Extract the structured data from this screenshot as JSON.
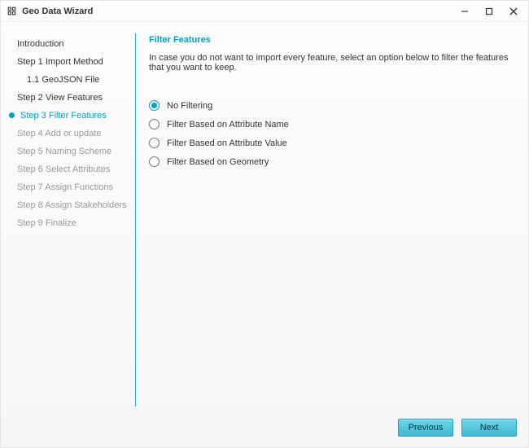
{
  "window": {
    "title": "Geo Data Wizard"
  },
  "sidebar": {
    "items": [
      {
        "label": "Introduction",
        "state": "past",
        "indent": 0
      },
      {
        "label": "Step 1 Import Method",
        "state": "past",
        "indent": 0
      },
      {
        "label": "1.1 GeoJSON File",
        "state": "past",
        "indent": 1
      },
      {
        "label": "Step 2 View Features",
        "state": "past",
        "indent": 0
      },
      {
        "label": "Step 3 Filter Features",
        "state": "active",
        "indent": 0
      },
      {
        "label": "Step 4 Add or update",
        "state": "future",
        "indent": 0
      },
      {
        "label": "Step 5 Naming Scheme",
        "state": "future",
        "indent": 0
      },
      {
        "label": "Step 6 Select Attributes",
        "state": "future",
        "indent": 0
      },
      {
        "label": "Step 7 Assign Functions",
        "state": "future",
        "indent": 0
      },
      {
        "label": "Step 8 Assign Stakeholders",
        "state": "future",
        "indent": 0
      },
      {
        "label": "Step 9 Finalize",
        "state": "future",
        "indent": 0
      }
    ]
  },
  "main": {
    "title": "Filter Features",
    "description": "In case you do not want to import every feature, select an option below to filter the features that you want to keep.",
    "options": [
      {
        "label": "No Filtering",
        "selected": true
      },
      {
        "label": "Filter Based on Attribute Name",
        "selected": false
      },
      {
        "label": "Filter Based on Attribute Value",
        "selected": false
      },
      {
        "label": "Filter Based on Geometry",
        "selected": false
      }
    ]
  },
  "footer": {
    "previous": "Previous",
    "next": "Next"
  }
}
